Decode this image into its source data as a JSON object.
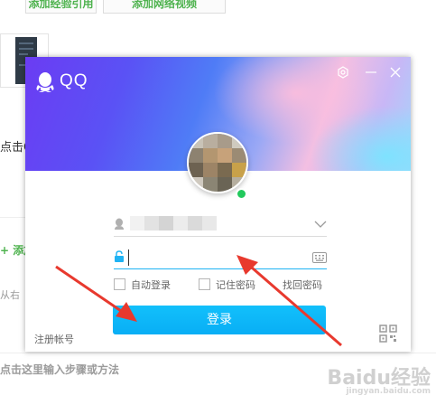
{
  "background_page": {
    "top_buttons": [
      "添加经验引用",
      "添加网络视频"
    ],
    "left_text": "点击Q",
    "add_label": "+ 添加",
    "hint_text": "从右",
    "step_placeholder": "点击这里输入步骤或方法",
    "watermark": "Baidu经验",
    "watermark_sub": "jingyan.baidu.com"
  },
  "qq_window": {
    "app_title": "QQ",
    "window_controls": [
      "settings-icon",
      "minimize-icon",
      "close-icon"
    ],
    "options": {
      "auto_login": "自动登录",
      "remember_password": "记住密码",
      "find_password": "找回密码"
    },
    "login_button": "登录",
    "register_link": "注册帐号",
    "avatar_status": "online"
  },
  "colors": {
    "accent_blue": "#12b7f5",
    "online_green": "#22c95d",
    "arrow_red": "#e8392e",
    "page_green": "#4fb34f"
  }
}
